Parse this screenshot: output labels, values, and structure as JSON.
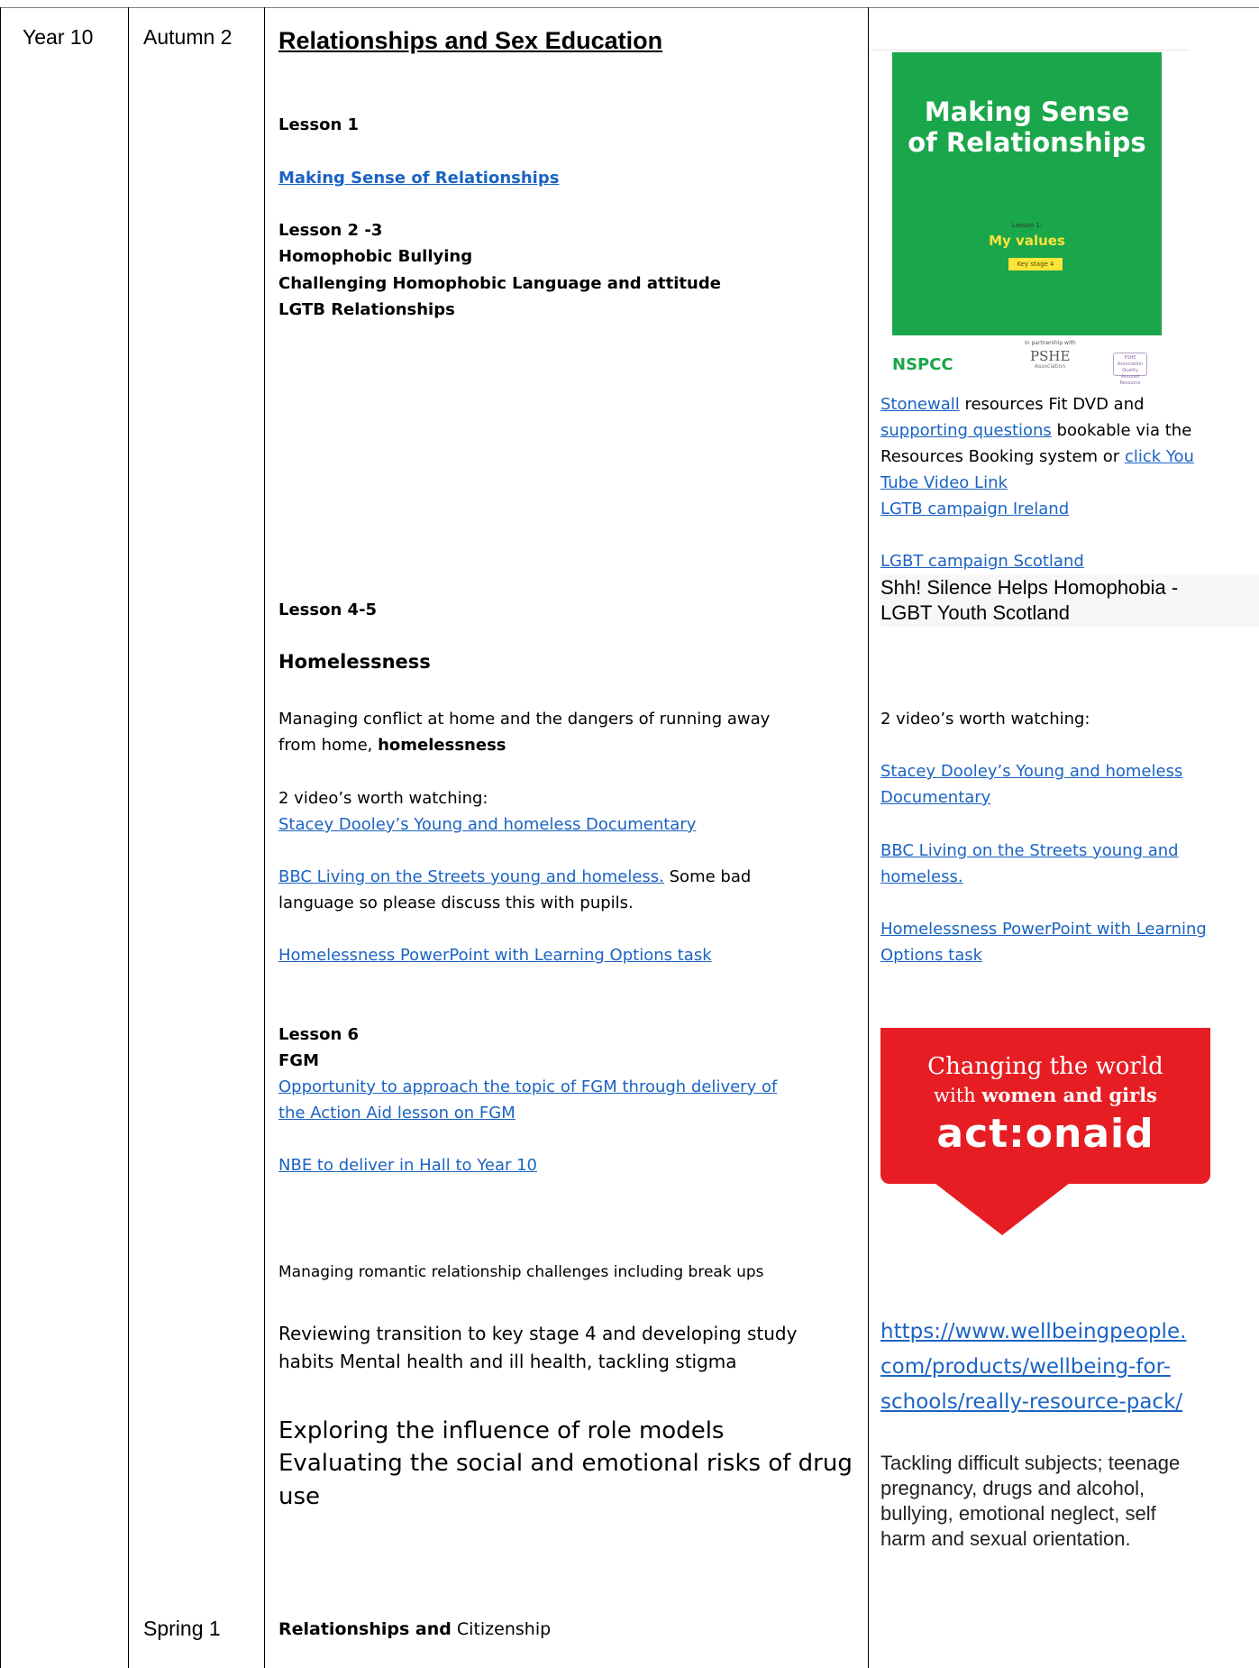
{
  "table": {
    "year": "Year 10",
    "term_autumn": "Autumn 2",
    "term_spring": "Spring 1"
  },
  "main": {
    "heading": "Relationships and Sex Education",
    "lesson1": "Lesson 1",
    "lesson1_link": "Making Sense of Relationships",
    "lesson23": "Lesson 2 -3",
    "homophobic_bullying": "Homophobic Bullying",
    "challenging": "Challenging Homophobic Language and attitude",
    "lgtb_relationships": "LGTB Relationships",
    "lesson45": "Lesson 4-5",
    "homelessness": "Homelessness",
    "managing_conflict_1": "Managing conflict at home and the dangers of running away",
    "managing_conflict_2": "from home, ",
    "managing_conflict_bold": "homelessness",
    "videos": "2 video’s worth watching:",
    "stacey_link": "Stacey Dooley’s Young and homeless Documentary",
    "bbc_link": "BBC Living on the Streets young and homeless.",
    "bbc_note_1": " Some bad",
    "bbc_note_2": "language so please discuss this with pupils.",
    "ppt_link": "Homelessness PowerPoint with Learning Options task",
    "lesson6": "Lesson 6",
    "fgm": "FGM",
    "fgm_link_1": "Opportunity to approach the topic of FGM through delivery of",
    "fgm_link_2": "the Action Aid lesson on FGM",
    "nbe_link": "NBE to deliver in Hall to Year 10",
    "romantic": "Managing romantic relationship challenges including break ups",
    "reviewing_1": "Reviewing transition to key stage 4 and developing study",
    "reviewing_2": "habits Mental health and ill health, tackling stigma",
    "role_models": "Exploring the influence of role models",
    "evaluating_1": "Evaluating the social and emotional risks of drug",
    "evaluating_2": "use",
    "spring_bold": "Relationships and",
    "spring_rest": " Citizenship"
  },
  "resources": {
    "cover_title_1": "Making Sense",
    "cover_title_2": "of Relationships",
    "cover_lesson": "Lesson 1:",
    "cover_sub": "My values",
    "cover_ks": "Key stage 4",
    "nspcc": "NSPCC",
    "partner": "In partnership with",
    "pshe": "PSHE",
    "pshe_assoc": "Association",
    "qa": "PSHE Association Quality Assured Resource",
    "stonewall_link": "Stonewall",
    "stonewall_text": " resources Fit DVD and",
    "supporting_link": "supporting questions",
    "supporting_text": " bookable via the",
    "booking_text": "Resources Booking system or ",
    "click_link": "click You",
    "tube_link": "Tube Video Link",
    "ireland_link": "LGTB campaign Ireland",
    "scotland_link": "LGBT campaign Scotland",
    "shh_1": "Shh! Silence Helps Homophobia -",
    "shh_2": "LGBT Youth Scotland",
    "videos": "2 video’s worth watching:",
    "stacey_1": "Stacey Dooley’s Young and homeless",
    "stacey_2": "Documentary",
    "bbc_1": "BBC Living on the Streets young and",
    "bbc_2": "homeless.",
    "ppt_1": "Homelessness PowerPoint with Learning",
    "ppt_2": "Options task",
    "aa_line1": "Changing the world",
    "aa_line2_pre": "with ",
    "aa_line2_bold": "women and girls",
    "aa_logo": "act:onaid",
    "wellbeing_1": "https://www.wellbeingpeople.",
    "wellbeing_2": "com/products/wellbeing-for-",
    "wellbeing_3": "schools/really-resource-pack/",
    "tackling_1": "Tackling difficult subjects; teenage",
    "tackling_2": "pregnancy, drugs and alcohol,",
    "tackling_3": "bullying, emotional neglect, self",
    "tackling_4": "harm and sexual orientation."
  },
  "colors": {
    "link": "#1b63c2",
    "green": "#1aa64a",
    "red": "#e61e24",
    "yellow": "#ffe43a"
  }
}
